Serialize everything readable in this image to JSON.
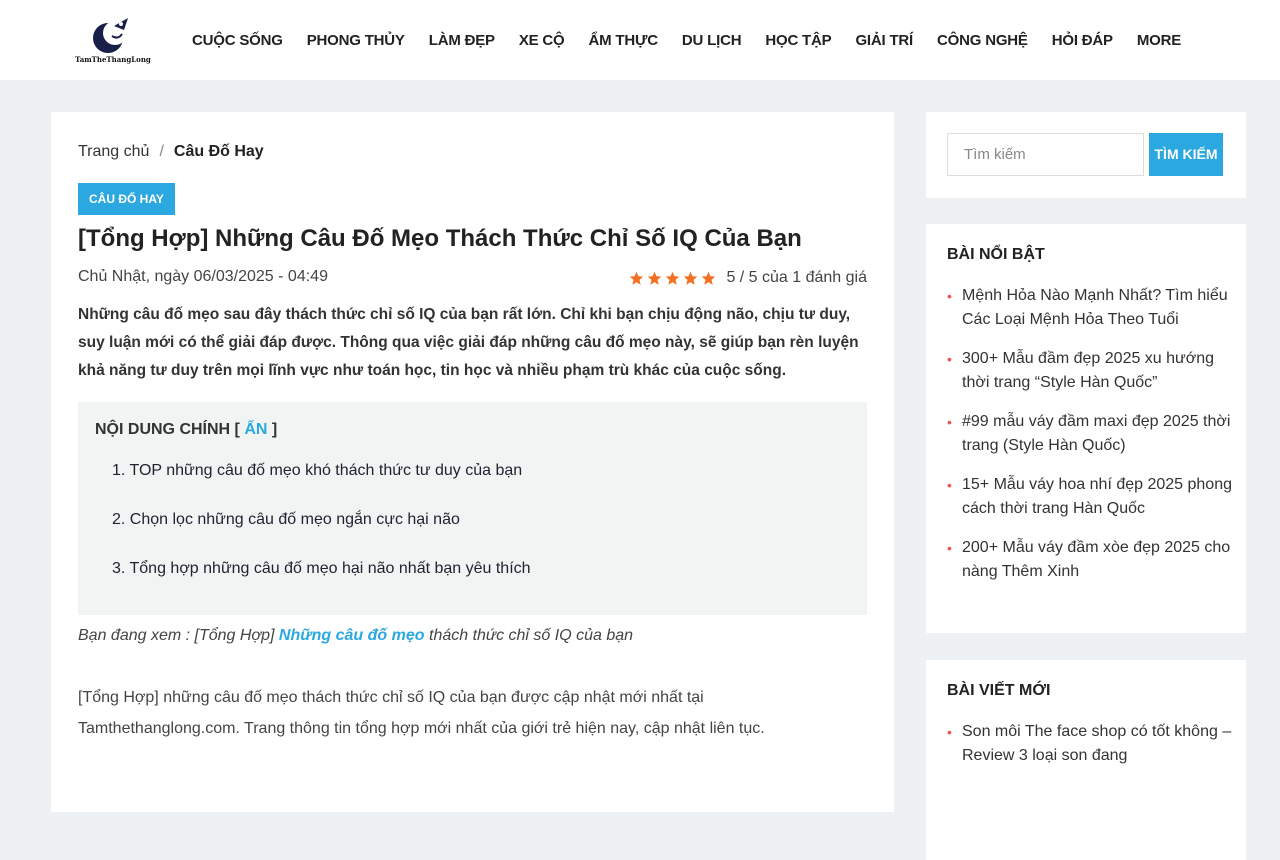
{
  "header": {
    "logo_text": "TamTheThangLong",
    "nav": [
      "CUỘC SỐNG",
      "PHONG THỦY",
      "LÀM ĐẸP",
      "XE CỘ",
      "ẨM THỰC",
      "DU LỊCH",
      "HỌC TẬP",
      "GIẢI TRÍ",
      "CÔNG NGHỆ",
      "HỎI ĐÁP",
      "MORE"
    ]
  },
  "article": {
    "breadcrumb": {
      "home": "Trang chủ",
      "separator": "/",
      "current": "Câu Đố Hay"
    },
    "category": "CÂU ĐỐ HAY",
    "title": "[Tổng Hợp] Những Câu Đố Mẹo Thách Thức Chỉ Số IQ Của Bạn",
    "date": "Chủ Nhật, ngày 06/03/2025 - 04:49",
    "rating": {
      "stars": 5,
      "text": "5 / 5 của 1 đánh giá"
    },
    "intro": "Những câu đố mẹo sau đây thách thức chỉ số IQ của bạn rất lớn. Chỉ khi bạn chịu động não, chịu tư duy, suy luận mới có thể giải đáp được. Thông qua việc giải đáp những câu đố mẹo này, sẽ giúp bạn rèn luyện khả năng tư duy trên mọi lĩnh vực như toán học, tin học và nhiều phạm trù khác của cuộc sống.",
    "toc": {
      "title_prefix": "NỘI DUNG CHÍNH [ ",
      "toggle": "ẨN",
      "title_suffix": " ]",
      "items": [
        "1. TOP những câu đố mẹo khó thách thức tư duy của bạn",
        "2. Chọn lọc những câu đố mẹo ngắn cực hại não",
        "3. Tổng hợp những câu đố mẹo hại não nhất bạn yêu thích"
      ]
    },
    "viewing": {
      "prefix": "Bạn đang xem : [Tổng Hợp] ",
      "link": "Những câu đố mẹo",
      "suffix": " thách thức chỉ số IQ của bạn"
    },
    "body": "[Tổng Hợp] những câu đố mẹo thách thức chỉ số IQ của bạn được cập nhật mới nhất tại Tamthethanglong.com. Trang thông tin tổng hợp mới nhất của giới trẻ hiện nay, cập nhật liên tục."
  },
  "sidebar": {
    "search": {
      "placeholder": "Tìm kiếm",
      "button": "TÌM KIẾM"
    },
    "featured": {
      "heading": "BÀI NỔI BẬT",
      "items": [
        "Mệnh Hỏa Nào Mạnh Nhất? Tìm hiểu Các Loại Mệnh Hỏa Theo Tuổi",
        "300+ Mẫu đầm đẹp 2025 xu hướng thời trang “Style Hàn Quốc”",
        "#99 mẫu váy đầm maxi đẹp 2025 thời trang (Style Hàn Quốc)",
        "15+ Mẫu váy hoa nhí đẹp 2025 phong cách thời trang Hàn Quốc",
        "200+ Mẫu váy đầm xòe đẹp 2025 cho nàng Thêm Xinh"
      ]
    },
    "recent": {
      "heading": "BÀI VIẾT MỚI",
      "items": [
        "Son môi The face shop có tốt không – Review 3 loại son đang"
      ]
    }
  },
  "colors": {
    "accent": "#2aa8df",
    "star": "#f36f21",
    "bullet": "#e55555",
    "page_bg": "#eef1f4"
  }
}
